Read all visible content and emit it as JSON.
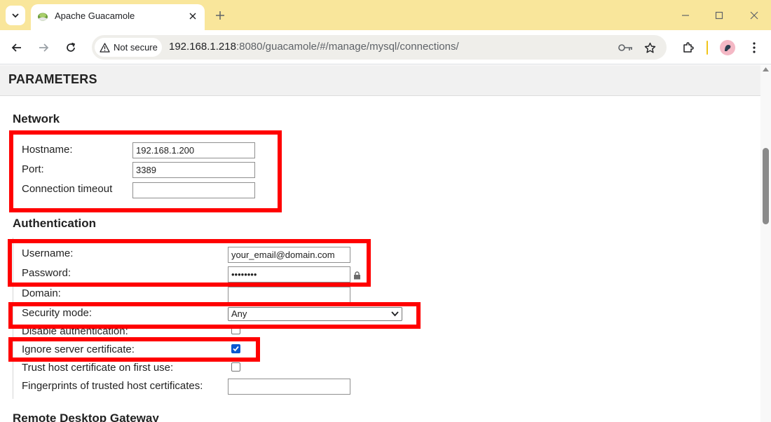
{
  "browser": {
    "tab_title": "Apache Guacamole",
    "security_chip": "Not secure",
    "url_host": "192.168.1.218",
    "url_rest": ":8080/guacamole/#/manage/mysql/connections/"
  },
  "page": {
    "header": "PARAMETERS",
    "network": {
      "title": "Network",
      "hostname_label": "Hostname:",
      "hostname_value": "192.168.1.200",
      "port_label": "Port:",
      "port_value": "3389",
      "timeout_label": "Connection timeout",
      "timeout_value": ""
    },
    "authentication": {
      "title": "Authentication",
      "username_label": "Username:",
      "username_value": "your_email@domain.com",
      "password_label": "Password:",
      "password_value": "••••••••",
      "domain_label": "Domain:",
      "domain_value": "",
      "security_label": "Security mode:",
      "security_value": "Any",
      "disable_auth_label": "Disable authentication:",
      "disable_auth_checked": false,
      "ignore_cert_label": "Ignore server certificate:",
      "ignore_cert_checked": true,
      "trust_host_label": "Trust host certificate on first use:",
      "trust_host_checked": false,
      "fingerprints_label": "Fingerprints of trusted host certificates:",
      "fingerprints_value": ""
    },
    "gateway": {
      "title": "Remote Desktop Gateway"
    }
  },
  "colors": {
    "tabstrip": "#f9e69b",
    "highlight": "#ff0000",
    "checkbox_checked": "#0b57d0"
  },
  "icons": [
    "tab-search-icon",
    "guacamole-favicon-icon",
    "close-icon",
    "plus-icon",
    "minimize-icon",
    "maximize-icon",
    "window-close-icon",
    "back-arrow-icon",
    "forward-arrow-icon",
    "reload-icon",
    "warning-icon",
    "password-key-icon",
    "bookmark-star-icon",
    "extensions-icon",
    "profile-avatar-icon",
    "kebab-menu-icon",
    "lock-icon"
  ]
}
